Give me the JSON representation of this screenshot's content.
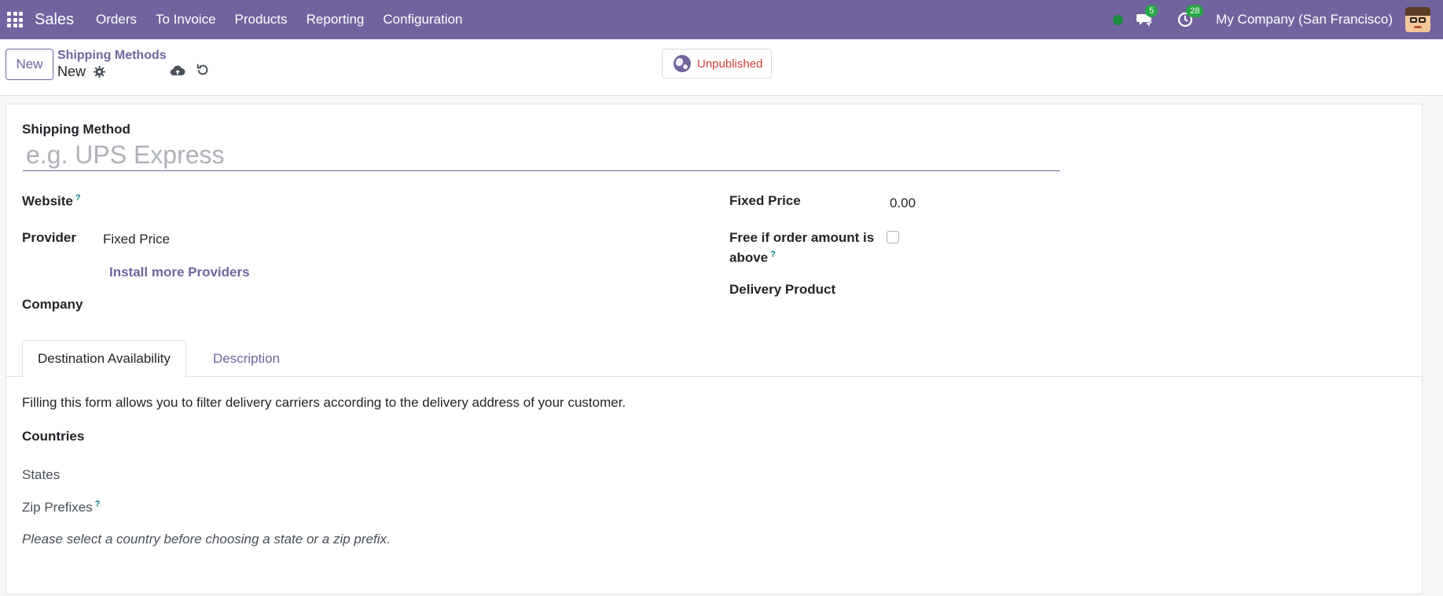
{
  "navbar": {
    "app_name": "Sales",
    "menu": [
      "Orders",
      "To Invoice",
      "Products",
      "Reporting",
      "Configuration"
    ],
    "messages_count": "5",
    "activities_count": "28",
    "company": "My Company (San Francisco)",
    "accent": "#71639e"
  },
  "control_panel": {
    "new_label": "New",
    "breadcrumb_parent": "Shipping Methods",
    "breadcrumb_current": "New",
    "publish_label": "Unpublished"
  },
  "form": {
    "shipping_method_label": "Shipping Method",
    "shipping_method_placeholder": "e.g. UPS Express",
    "website_label": "Website",
    "help_mark": "?",
    "provider_label": "Provider",
    "provider_value": "Fixed Price",
    "install_providers": "Install more Providers",
    "company_label": "Company",
    "fixed_price_label": "Fixed Price",
    "fixed_price_value": "0.00",
    "free_if_label_1": "Free if order amount is",
    "free_if_label_2": "above",
    "delivery_product_label": "Delivery Product"
  },
  "tabs": {
    "destination": "Destination Availability",
    "description": "Description"
  },
  "destination": {
    "intro": "Filling this form allows you to filter delivery carriers according to the delivery address of your customer.",
    "countries_label": "Countries",
    "states_label": "States",
    "zip_label": "Zip Prefixes",
    "note": "Please select a country before choosing a state or a zip prefix."
  }
}
